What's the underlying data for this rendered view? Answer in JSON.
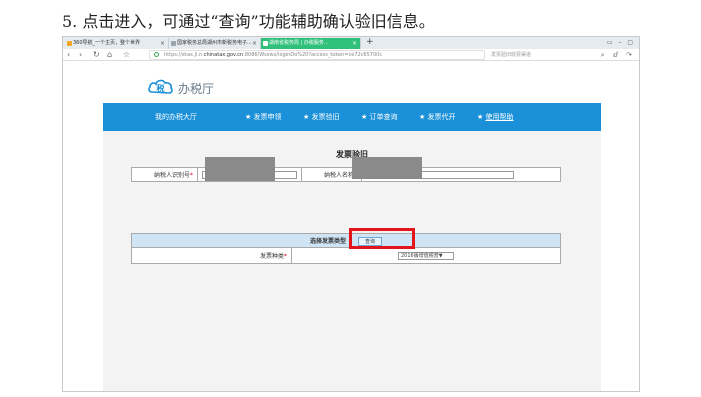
{
  "caption": "5. 点击进入，可通过“查询”功能辅助确认验旧信息。",
  "browser": {
    "tabs": [
      {
        "label": "360导航_一个主页，整个世界",
        "color": "#f5a623"
      },
      {
        "label": "国家税务总局湖州市新税务电子...",
        "color": "#9aa4ae"
      },
      {
        "label": "湖南省税务局 | 办税服务...",
        "color": "#ffffff"
      }
    ],
    "new_tab": "+",
    "window_controls": "▭ – ▢",
    "nav": {
      "back": "‹",
      "forward": "›",
      "reload": "↻",
      "home": "⌂",
      "star": "☆"
    },
    "url_prefix": "https://etax.jl.n.",
    "url_domain": "chinatax.gov.cn",
    "url_rest": ":8086/Wsswx/loginDo%20?access_token=ce72c65700c",
    "search_placeholder": "发票验旧收票渠道",
    "right_controls": "⌕ ⅆ ↷"
  },
  "site": {
    "logo_text": "办税厅",
    "nav_items": [
      {
        "label": "我的办税大厅",
        "star": false
      },
      {
        "label": "发票申领",
        "star": true
      },
      {
        "label": "发票验旧",
        "star": true
      },
      {
        "label": "订单查询",
        "star": true
      },
      {
        "label": "发票代开",
        "star": true
      },
      {
        "label": "使用帮助",
        "star": true,
        "underline": true
      }
    ],
    "page_title": "发票验旧",
    "fields": {
      "taxpayer_id_label": "纳税人识别号",
      "taxpayer_name_label": "纳税人名称",
      "taxpayer_id_value": "3",
      "taxpayer_name_value": "司"
    },
    "section_title": "选择发票类型",
    "query_button": "查询",
    "invoice_kind_label": "发票种类",
    "invoice_kind_selected": "2016版增值税普▼"
  },
  "colors": {
    "nav_bg": "#1a90d8",
    "section_bg": "#cfe4f4",
    "highlight": "#e4141b",
    "required": "#d0021b"
  }
}
